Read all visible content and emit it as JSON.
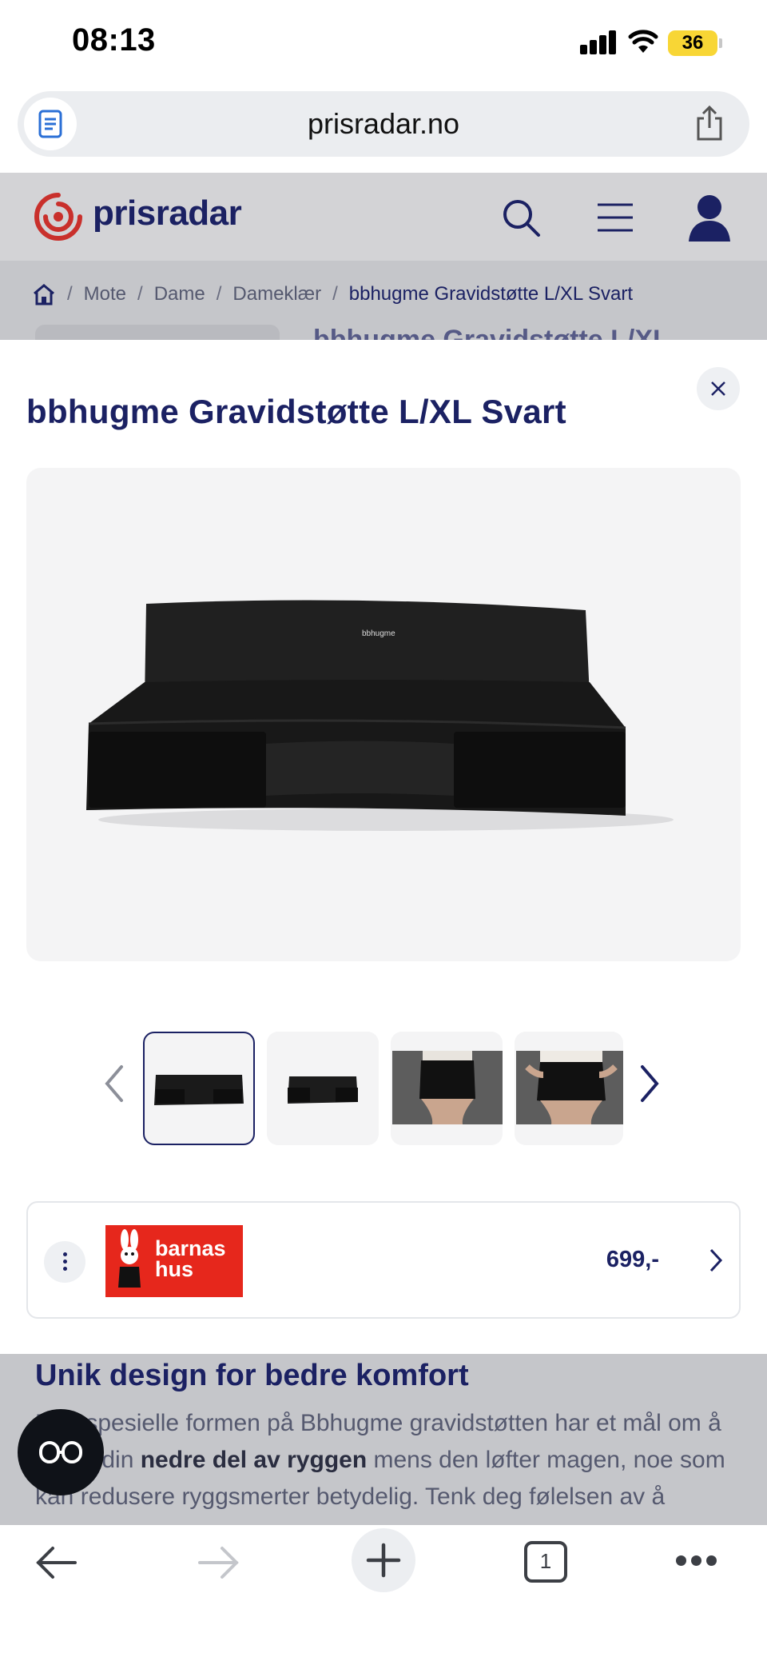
{
  "status_bar": {
    "time": "08:13",
    "battery": "36"
  },
  "browser": {
    "url": "prisradar.no",
    "tab_count": "1"
  },
  "site": {
    "logo_text": "prisradar"
  },
  "breadcrumb": [
    "Mote",
    "Dame",
    "Dameklær",
    "bbhugme Gravidstøtte L/XL Svart"
  ],
  "background_title": "bbhugme Gravidstøtte L/XL",
  "sheet": {
    "title": "bbhugme Gravidstøtte L/XL Svart"
  },
  "offer": {
    "store_name": "barnas\nhus",
    "price": "699,-"
  },
  "below": {
    "heading": "Unik design for bedre komfort",
    "paragraph_a": "Den spesielle formen på Bbhugme gravidstøtten har et mål om å støtte din ",
    "paragraph_bold": "nedre del av ryggen",
    "paragraph_b": " mens den løfter magen, noe som kan redusere ryggsmerter betydelig. Tenk deg følelsen av å"
  },
  "colors": {
    "brand_navy": "#1b2163",
    "store_red": "#e6271c",
    "battery_yellow": "#f8d635"
  }
}
